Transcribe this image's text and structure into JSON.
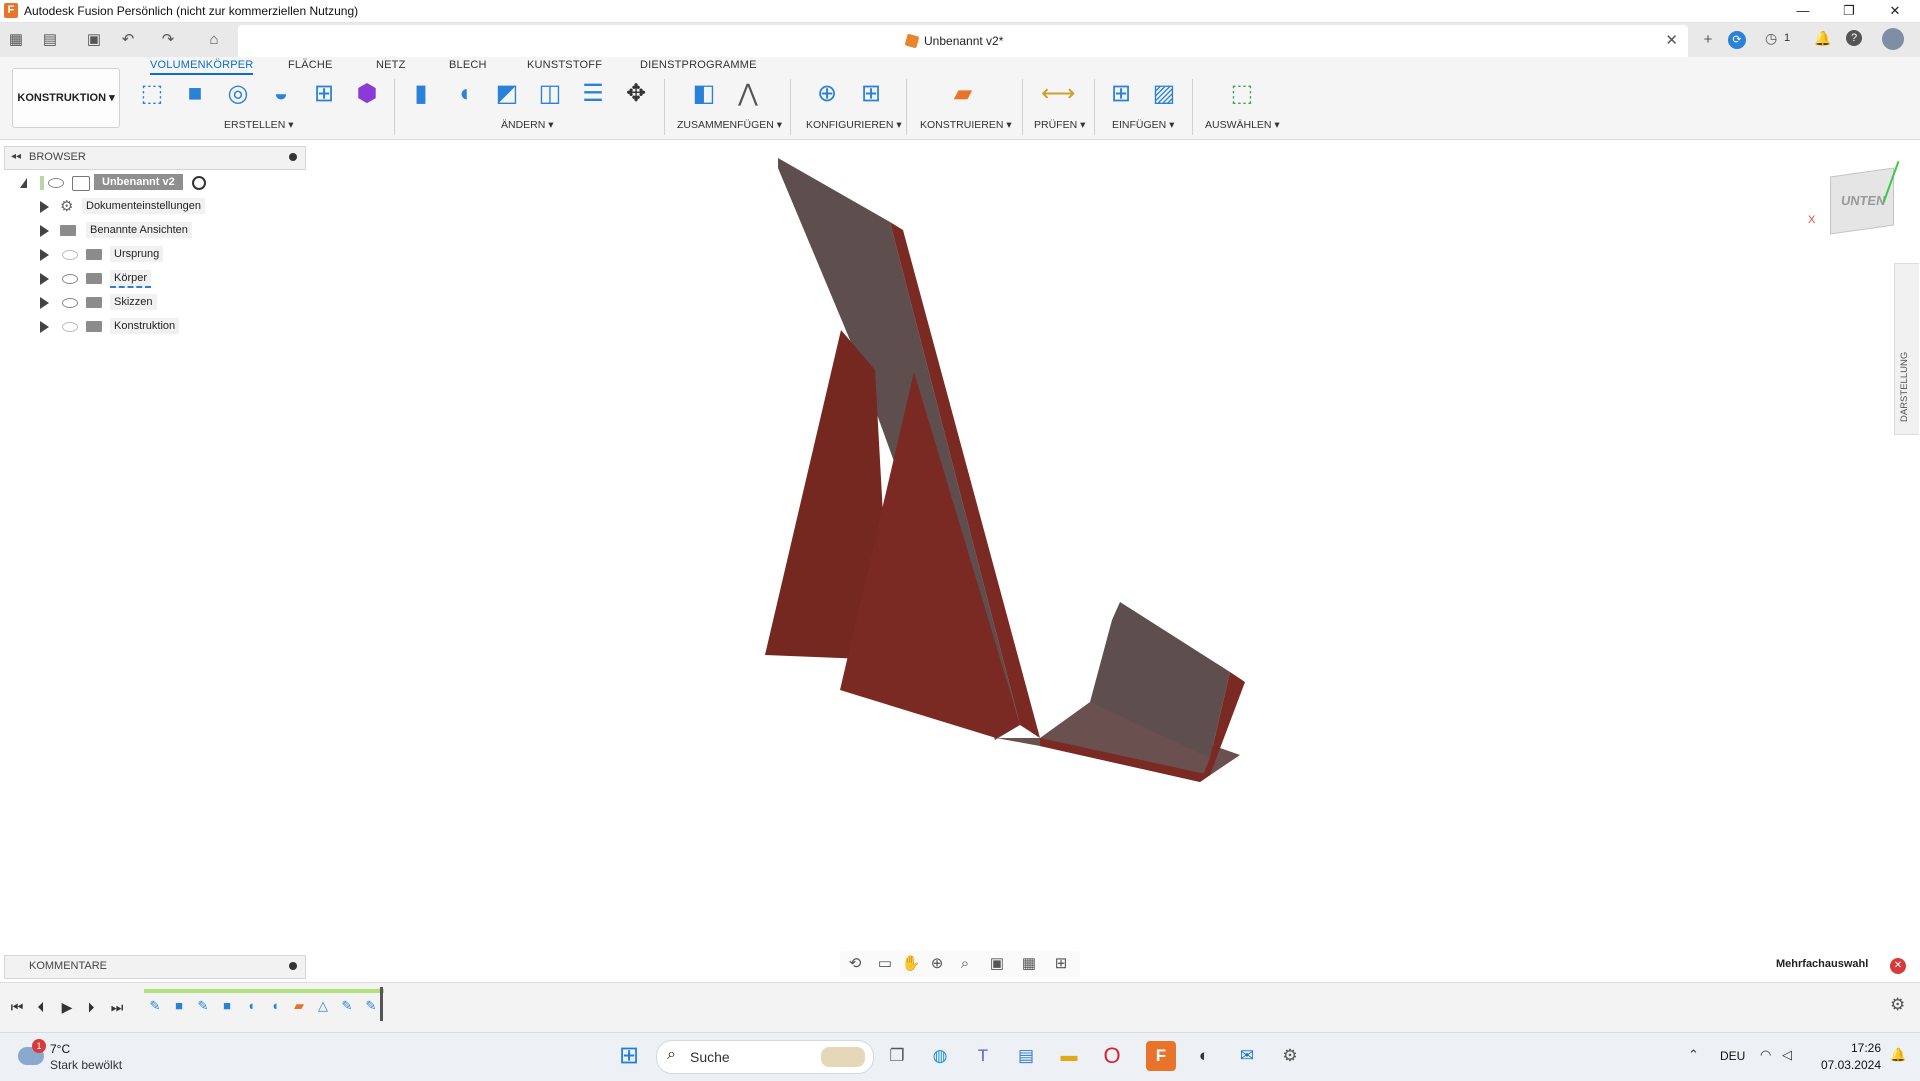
{
  "window": {
    "title": "Autodesk Fusion Persönlich (nicht zur kommerziellen Nutzung)",
    "logo_letter": "F",
    "minimize": "—",
    "maximize": "❐",
    "close": "✕"
  },
  "document_tab": {
    "name": "Unbenannt v2*",
    "close": "✕"
  },
  "header_right": {
    "jobs_count": "1"
  },
  "ribbon": {
    "tabs": [
      "VOLUMENKÖRPER",
      "FLÄCHE",
      "NETZ",
      "BLECH",
      "KUNSTSTOFF",
      "DIENSTPROGRAMME"
    ],
    "active_tab": "VOLUMENKÖRPER",
    "workspace": "KONSTRUKTION ▾",
    "groups": [
      "ERSTELLEN ▾",
      "ÄNDERN ▾",
      "ZUSAMMENFÜGEN ▾",
      "KONFIGURIEREN ▾",
      "KONSTRUIEREN ▾",
      "PRÜFEN ▾",
      "EINFÜGEN ▾",
      "AUSWÄHLEN ▾"
    ]
  },
  "browser": {
    "title": "BROWSER",
    "root": "Unbenannt v2",
    "items": [
      "Dokumenteinstellungen",
      "Benannte Ansichten",
      "Ursprung",
      "Körper",
      "Skizzen",
      "Konstruktion"
    ]
  },
  "viewcube": {
    "face": "UNTEN",
    "axis_x": "X"
  },
  "right_panel": {
    "label": "DARSTELLUNG"
  },
  "comments": {
    "title": "KOMMENTARE"
  },
  "selection": {
    "label": "Mehrfachauswahl"
  },
  "taskbar": {
    "weather_temp": "7°C",
    "weather_text": "Stark bewölkt",
    "weather_badge": "1",
    "search_placeholder": "Suche",
    "language": "DEU",
    "time": "17:26",
    "date": "07.03.2024"
  },
  "colors": {
    "accent": "#0b6ecf",
    "model_body": "#7a2a22",
    "model_face": "#5e4a4a",
    "brand": "#e8742b"
  }
}
